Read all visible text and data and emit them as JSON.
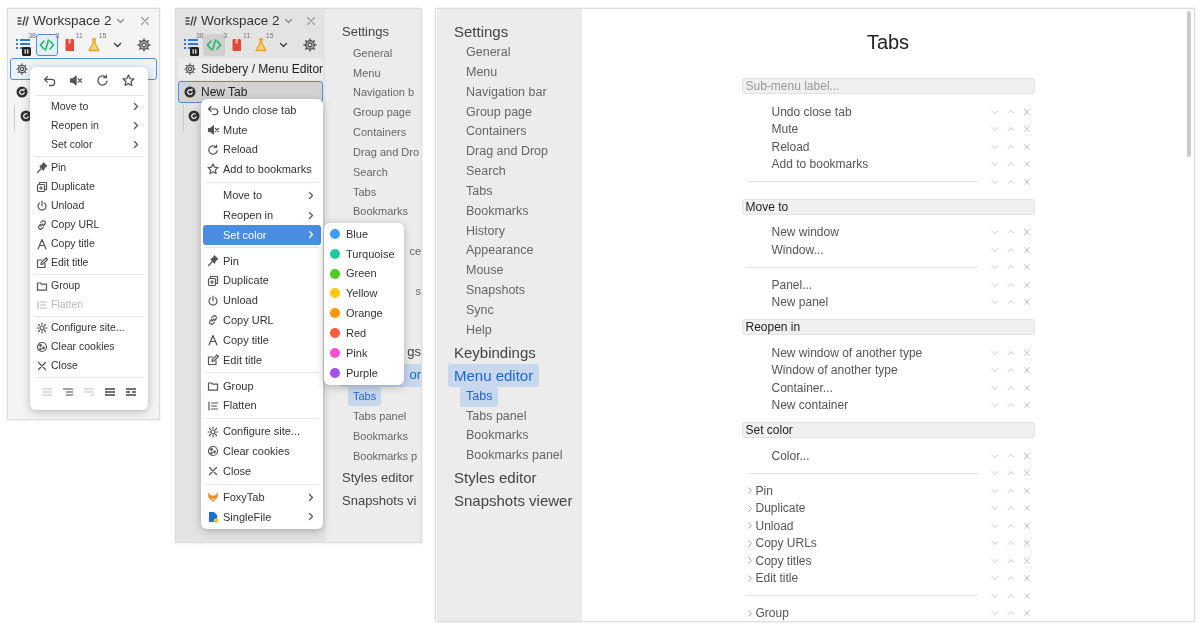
{
  "window_one": {
    "sidebar": {
      "title": "Workspace 2",
      "toolbar": [
        {
          "count": "38",
          "selected": false,
          "paused": true
        },
        {
          "count": "3",
          "selected": true,
          "paused": false
        },
        {
          "count": "11",
          "selected": false,
          "paused": false
        },
        {
          "count": "15",
          "selected": false,
          "paused": false
        }
      ],
      "tabs": [
        {
          "selected": true
        },
        {
          "selected": false
        }
      ]
    },
    "context_menu": {
      "items": [
        {
          "kind": "submenu",
          "label": "Move to"
        },
        {
          "kind": "submenu",
          "label": "Reopen in"
        },
        {
          "kind": "submenu",
          "label": "Set color"
        },
        {
          "kind": "separator"
        },
        {
          "kind": "action",
          "label": "Pin",
          "disabled": false
        },
        {
          "kind": "action",
          "label": "Duplicate",
          "disabled": false
        },
        {
          "kind": "action",
          "label": "Unload",
          "disabled": false
        },
        {
          "kind": "action",
          "label": "Copy URL",
          "disabled": false
        },
        {
          "kind": "action",
          "label": "Copy title",
          "disabled": false
        },
        {
          "kind": "action",
          "label": "Edit title",
          "disabled": false
        },
        {
          "kind": "separator"
        },
        {
          "kind": "action",
          "label": "Group",
          "disabled": false
        },
        {
          "kind": "action",
          "label": "Flatten",
          "disabled": true
        },
        {
          "kind": "separator"
        },
        {
          "kind": "action",
          "label": "Configure site...",
          "disabled": false
        },
        {
          "kind": "action",
          "label": "Clear cookies",
          "disabled": false
        },
        {
          "kind": "action",
          "label": "Close",
          "disabled": false
        }
      ],
      "bottom_icons": [
        {
          "disabled": true
        },
        {
          "disabled": false
        },
        {
          "disabled": true
        },
        {
          "disabled": false
        },
        {
          "disabled": false
        }
      ]
    }
  },
  "window_two": {
    "sidebar": {
      "title": "Workspace 2",
      "toolbar": [
        {
          "count": "38",
          "selected": false,
          "paused": true
        },
        {
          "count": "3",
          "selected": true,
          "paused": false
        },
        {
          "count": "11",
          "selected": false,
          "paused": false
        },
        {
          "count": "15",
          "selected": false,
          "paused": false
        }
      ],
      "tabs": [
        {
          "title": "Sidebery / Menu Editor",
          "selected": false
        },
        {
          "title": "New Tab",
          "selected": true
        }
      ]
    },
    "context_menu": {
      "items": [
        {
          "kind": "action",
          "label": "Undo close tab",
          "disabled": false,
          "selected": false
        },
        {
          "kind": "action",
          "label": "Mute",
          "disabled": false,
          "selected": false
        },
        {
          "kind": "action",
          "label": "Reload",
          "disabled": false,
          "selected": false
        },
        {
          "kind": "action",
          "label": "Add to bookmarks",
          "disabled": false,
          "selected": false
        },
        {
          "kind": "separator"
        },
        {
          "kind": "submenu",
          "label": "Move to",
          "selected": false
        },
        {
          "kind": "submenu",
          "label": "Reopen in",
          "selected": false
        },
        {
          "kind": "submenu",
          "label": "Set color",
          "selected": true
        },
        {
          "kind": "separator"
        },
        {
          "kind": "action",
          "label": "Pin",
          "disabled": false,
          "selected": false
        },
        {
          "kind": "action",
          "label": "Duplicate",
          "disabled": false,
          "selected": false
        },
        {
          "kind": "action",
          "label": "Unload",
          "disabled": false,
          "selected": false
        },
        {
          "kind": "action",
          "label": "Copy URL",
          "disabled": false,
          "selected": false
        },
        {
          "kind": "action",
          "label": "Copy title",
          "disabled": false,
          "selected": false
        },
        {
          "kind": "action",
          "label": "Edit title",
          "disabled": false,
          "selected": false
        },
        {
          "kind": "separator"
        },
        {
          "kind": "action",
          "label": "Group",
          "disabled": false,
          "selected": false
        },
        {
          "kind": "action",
          "label": "Flatten",
          "disabled": false,
          "selected": false
        },
        {
          "kind": "separator"
        },
        {
          "kind": "action",
          "label": "Configure site...",
          "disabled": false,
          "selected": false
        },
        {
          "kind": "action",
          "label": "Clear cookies",
          "disabled": false,
          "selected": false
        },
        {
          "kind": "action",
          "label": "Close",
          "disabled": false,
          "selected": false
        },
        {
          "kind": "separator"
        },
        {
          "kind": "extension",
          "label": "FoxyTab",
          "selected": false
        },
        {
          "kind": "extension",
          "label": "SingleFile",
          "selected": false
        }
      ]
    },
    "color_submenu": [
      {
        "label": "Blue",
        "color": "#3a9ff5"
      },
      {
        "label": "Turquoise",
        "color": "#1ec99f"
      },
      {
        "label": "Green",
        "color": "#4fcb1e"
      },
      {
        "label": "Yellow",
        "color": "#fcc70d"
      },
      {
        "label": "Orange",
        "color": "#ff9608"
      },
      {
        "label": "Red",
        "color": "#ff5b3e"
      },
      {
        "label": "Pink",
        "color": "#ff4fd2"
      },
      {
        "label": "Purple",
        "color": "#a24ff1"
      }
    ],
    "settings_nav": [
      {
        "kind": "heading",
        "label": "Settings",
        "selected": false
      },
      {
        "kind": "item",
        "label": "General",
        "selected": false
      },
      {
        "kind": "item",
        "label": "Menu",
        "selected": false
      },
      {
        "kind": "item",
        "label": "Navigation b",
        "selected": false
      },
      {
        "kind": "item",
        "label": "Group page",
        "selected": false
      },
      {
        "kind": "item",
        "label": "Containers",
        "selected": false
      },
      {
        "kind": "item",
        "label": "Drag and Dro",
        "selected": false
      },
      {
        "kind": "item",
        "label": "Search",
        "selected": false
      },
      {
        "kind": "item",
        "label": "Tabs",
        "selected": false
      },
      {
        "kind": "item",
        "label": "Bookmarks",
        "selected": false
      },
      {
        "kind": "covered"
      },
      {
        "kind": "item_tail",
        "label": "ce",
        "selected": false
      },
      {
        "kind": "covered"
      },
      {
        "kind": "item_tail",
        "label": "s",
        "selected": false
      },
      {
        "kind": "covered"
      },
      {
        "kind": "covered"
      },
      {
        "kind": "heading_tail",
        "label": "gs",
        "selected": false
      },
      {
        "kind": "heading_tail",
        "label": "or",
        "selected": true
      },
      {
        "kind": "item",
        "label": "Tabs",
        "selected": true
      },
      {
        "kind": "item",
        "label": "Tabs panel",
        "selected": false
      },
      {
        "kind": "item",
        "label": "Bookmarks",
        "selected": false
      },
      {
        "kind": "item",
        "label": "Bookmarks p",
        "selected": false
      },
      {
        "kind": "heading",
        "label": "Styles editor",
        "selected": false
      },
      {
        "kind": "heading",
        "label": "Snapshots vi",
        "selected": false
      }
    ]
  },
  "window_three": {
    "settings_nav": [
      {
        "label": "Settings",
        "selected": false,
        "children": [
          {
            "label": "General",
            "selected": false
          },
          {
            "label": "Menu",
            "selected": false
          },
          {
            "label": "Navigation bar",
            "selected": false
          },
          {
            "label": "Group page",
            "selected": false
          },
          {
            "label": "Containers",
            "selected": false
          },
          {
            "label": "Drag and Drop",
            "selected": false
          },
          {
            "label": "Search",
            "selected": false
          },
          {
            "label": "Tabs",
            "selected": false
          },
          {
            "label": "Bookmarks",
            "selected": false
          },
          {
            "label": "History",
            "selected": false
          },
          {
            "label": "Appearance",
            "selected": false
          },
          {
            "label": "Mouse",
            "selected": false
          },
          {
            "label": "Snapshots",
            "selected": false
          },
          {
            "label": "Sync",
            "selected": false
          },
          {
            "label": "Help",
            "selected": false
          }
        ]
      },
      {
        "label": "Keybindings",
        "selected": false
      },
      {
        "label": "Menu editor",
        "selected": true,
        "children": [
          {
            "label": "Tabs",
            "selected": true
          },
          {
            "label": "Tabs panel",
            "selected": false
          },
          {
            "label": "Bookmarks",
            "selected": false
          },
          {
            "label": "Bookmarks panel",
            "selected": false
          }
        ]
      },
      {
        "label": "Styles editor",
        "selected": false
      },
      {
        "label": "Snapshots viewer",
        "selected": false
      }
    ],
    "editor": {
      "title": "Tabs",
      "blocks": [
        {
          "kind": "submenu",
          "placeholder": "Sub-menu label...",
          "items": [
            {
              "kind": "option",
              "label": "Undo close tab"
            },
            {
              "kind": "option",
              "label": "Mute"
            },
            {
              "kind": "option",
              "label": "Reload"
            },
            {
              "kind": "option",
              "label": "Add to bookmarks"
            },
            {
              "kind": "separator"
            }
          ]
        },
        {
          "kind": "submenu",
          "value": "Move to",
          "items": [
            {
              "kind": "option",
              "label": "New window"
            },
            {
              "kind": "option",
              "label": "Window..."
            },
            {
              "kind": "separator"
            },
            {
              "kind": "option",
              "label": "Panel..."
            },
            {
              "kind": "option",
              "label": "New panel"
            }
          ]
        },
        {
          "kind": "submenu",
          "value": "Reopen in",
          "items": [
            {
              "kind": "option",
              "label": "New window of another type"
            },
            {
              "kind": "option",
              "label": "Window of another type"
            },
            {
              "kind": "option",
              "label": "Container..."
            },
            {
              "kind": "option",
              "label": "New container"
            }
          ]
        },
        {
          "kind": "submenu",
          "value": "Set color",
          "items": [
            {
              "kind": "option",
              "label": "Color..."
            },
            {
              "kind": "separator"
            }
          ]
        },
        {
          "kind": "option",
          "label": "Pin"
        },
        {
          "kind": "option",
          "label": "Duplicate"
        },
        {
          "kind": "option",
          "label": "Unload"
        },
        {
          "kind": "option",
          "label": "Copy URLs"
        },
        {
          "kind": "option",
          "label": "Copy titles"
        },
        {
          "kind": "option",
          "label": "Edit title"
        },
        {
          "kind": "separator"
        },
        {
          "kind": "option",
          "label": "Group"
        }
      ]
    }
  }
}
